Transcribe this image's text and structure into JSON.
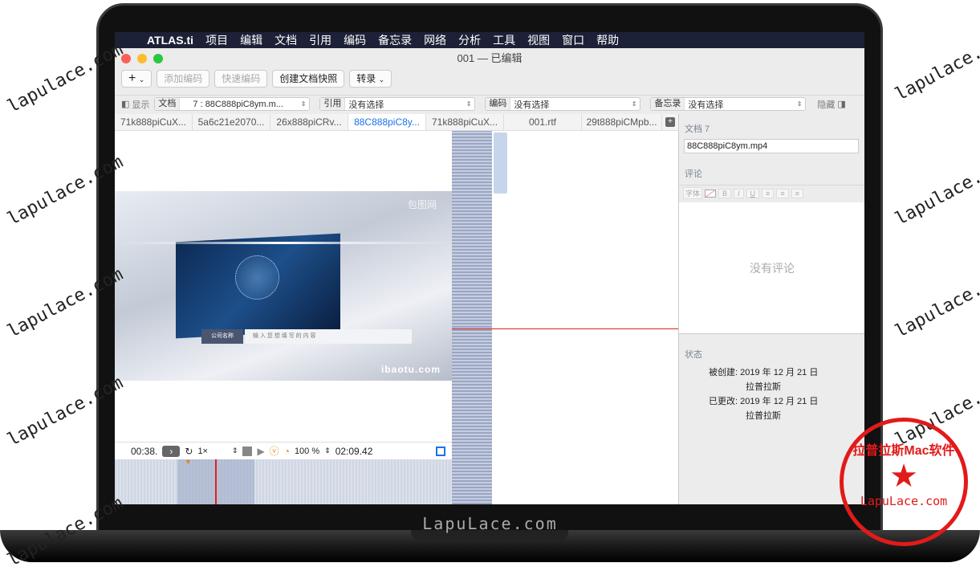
{
  "menubar": {
    "app": "ATLAS.ti",
    "items": [
      "项目",
      "编辑",
      "文档",
      "引用",
      "编码",
      "备忘录",
      "网络",
      "分析",
      "工具",
      "视图",
      "窗口",
      "帮助"
    ]
  },
  "window": {
    "title": "001 — 已编辑"
  },
  "toolbar": {
    "add": "+",
    "add_code": "添加编码",
    "quick_code": "快速编码",
    "snapshot": "创建文档快照",
    "transcribe": "转录"
  },
  "filter": {
    "show": "显示",
    "doc_label": "文档",
    "doc_value": "7 : 88C888piC8ym.m...",
    "quote_label": "引用",
    "quote_value": "没有选择",
    "code_label": "编码",
    "code_value": "没有选择",
    "memo_label": "备忘录",
    "memo_value": "没有选择",
    "hide": "隐藏"
  },
  "tabs": [
    "71k888piCuX...",
    "5a6c21e2070...",
    "26x888piCRv...",
    "88C888piC8y...",
    "71k888piCuX...",
    "001.rtf",
    "29t888piCMpb..."
  ],
  "video": {
    "watermark_top": "包图网",
    "watermark": "ibaotu.com",
    "company": "公司名称",
    "input_text": "输 入 您 想 填 写 的 内 容"
  },
  "player": {
    "current": "00:38.",
    "speed": "1×",
    "zoom": "100 %",
    "duration": "02:09.42"
  },
  "inspector": {
    "doc_title": "文档 7",
    "doc_name": "88C888piC8ym.mp4",
    "comment_label": "评论",
    "font_btn": "字体",
    "bold": "B",
    "italic": "I",
    "underline": "U",
    "no_comment": "没有评论",
    "status_label": "状态",
    "created_label": "被创建:",
    "created_date": "2019 年 12 月 21 日",
    "created_by": "拉普拉斯",
    "modified_label": "已更改:",
    "modified_date": "2019 年 12 月 21 日",
    "modified_by": "拉普拉斯"
  },
  "overlay": {
    "watermark": "lapulace.com",
    "brand": "LapuLace.com",
    "stamp_top": "拉普拉斯Mac软件",
    "stamp_bottom": "LapuLace.com"
  }
}
